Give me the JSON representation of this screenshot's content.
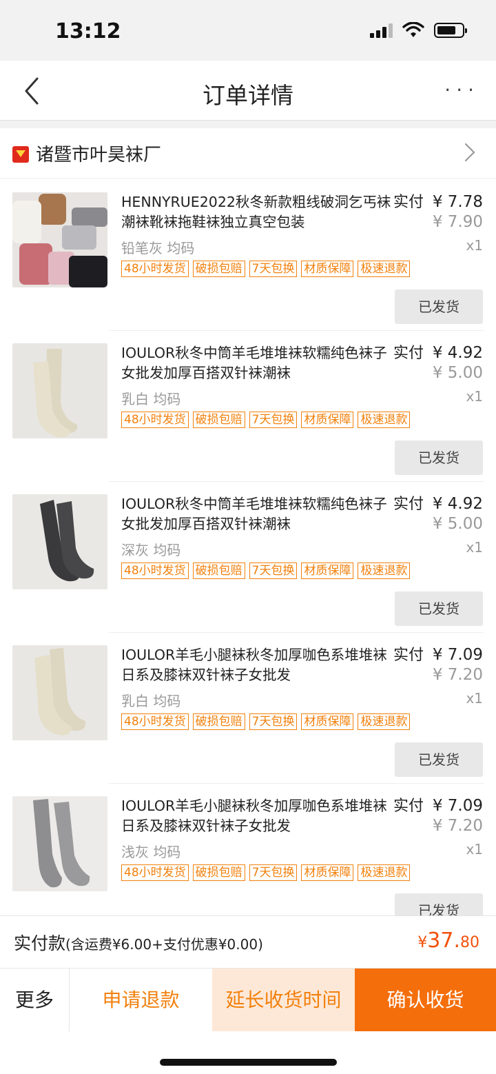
{
  "status_bar": {
    "time": "13:12"
  },
  "nav": {
    "title": "订单详情",
    "more": "···"
  },
  "shop": {
    "name": "诸暨市叶昊袜厂"
  },
  "items": [
    {
      "title": "HENNYRUE2022秋冬新款粗线破洞乞丐袜潮袜靴袜拖鞋袜独立真空包装",
      "paid_label": "实付",
      "paid_price": "¥ 7.78",
      "original_price": "¥ 7.90",
      "spec": "铅笔灰 均码",
      "quantity": "x1",
      "tags": [
        "48小时发货",
        "破损包赔",
        "7天包换",
        "材质保障",
        "极速退款"
      ],
      "button": "已发货"
    },
    {
      "title": "IOULOR秋冬中筒羊毛堆堆袜软糯纯色袜子女批发加厚百搭双针袜潮袜",
      "paid_label": "实付",
      "paid_price": "¥ 4.92",
      "original_price": "¥ 5.00",
      "spec": "乳白 均码",
      "quantity": "x1",
      "tags": [
        "48小时发货",
        "破损包赔",
        "7天包换",
        "材质保障",
        "极速退款"
      ],
      "button": "已发货"
    },
    {
      "title": "IOULOR秋冬中筒羊毛堆堆袜软糯纯色袜子女批发加厚百搭双针袜潮袜",
      "paid_label": "实付",
      "paid_price": "¥ 4.92",
      "original_price": "¥ 5.00",
      "spec": "深灰 均码",
      "quantity": "x1",
      "tags": [
        "48小时发货",
        "破损包赔",
        "7天包换",
        "材质保障",
        "极速退款"
      ],
      "button": "已发货"
    },
    {
      "title": "IOULOR羊毛小腿袜秋冬加厚咖色系堆堆袜日系及膝袜双针袜子女批发",
      "paid_label": "实付",
      "paid_price": "¥ 7.09",
      "original_price": "¥ 7.20",
      "spec": "乳白 均码",
      "quantity": "x1",
      "tags": [
        "48小时发货",
        "破损包赔",
        "7天包换",
        "材质保障",
        "极速退款"
      ],
      "button": "已发货"
    },
    {
      "title": "IOULOR羊毛小腿袜秋冬加厚咖色系堆堆袜日系及膝袜双针袜子女批发",
      "paid_label": "实付",
      "paid_price": "¥ 7.09",
      "original_price": "¥ 7.20",
      "spec": "浅灰 均码",
      "quantity": "x1",
      "tags": [
        "48小时发货",
        "破损包赔",
        "7天包换",
        "材质保障",
        "极速退款"
      ],
      "button": "已发货"
    }
  ],
  "total": {
    "label": "实付款",
    "note": "(含运费¥6.00+支付优惠¥0.00)",
    "currency": "¥",
    "integer": "37.",
    "decimal": "80"
  },
  "actions": {
    "more": "更多",
    "refund": "申请退款",
    "extend": "延长收货时间",
    "confirm": "确认收货"
  },
  "colors": {
    "accent": "#f46e0c",
    "tag": "#f2800c",
    "extend_bg": "#fde8d8",
    "price_total": "#f2510c"
  },
  "icons": {
    "back": "chevron-left-icon",
    "shop": "tmall-shop-icon",
    "chevron": "chevron-right-icon"
  }
}
